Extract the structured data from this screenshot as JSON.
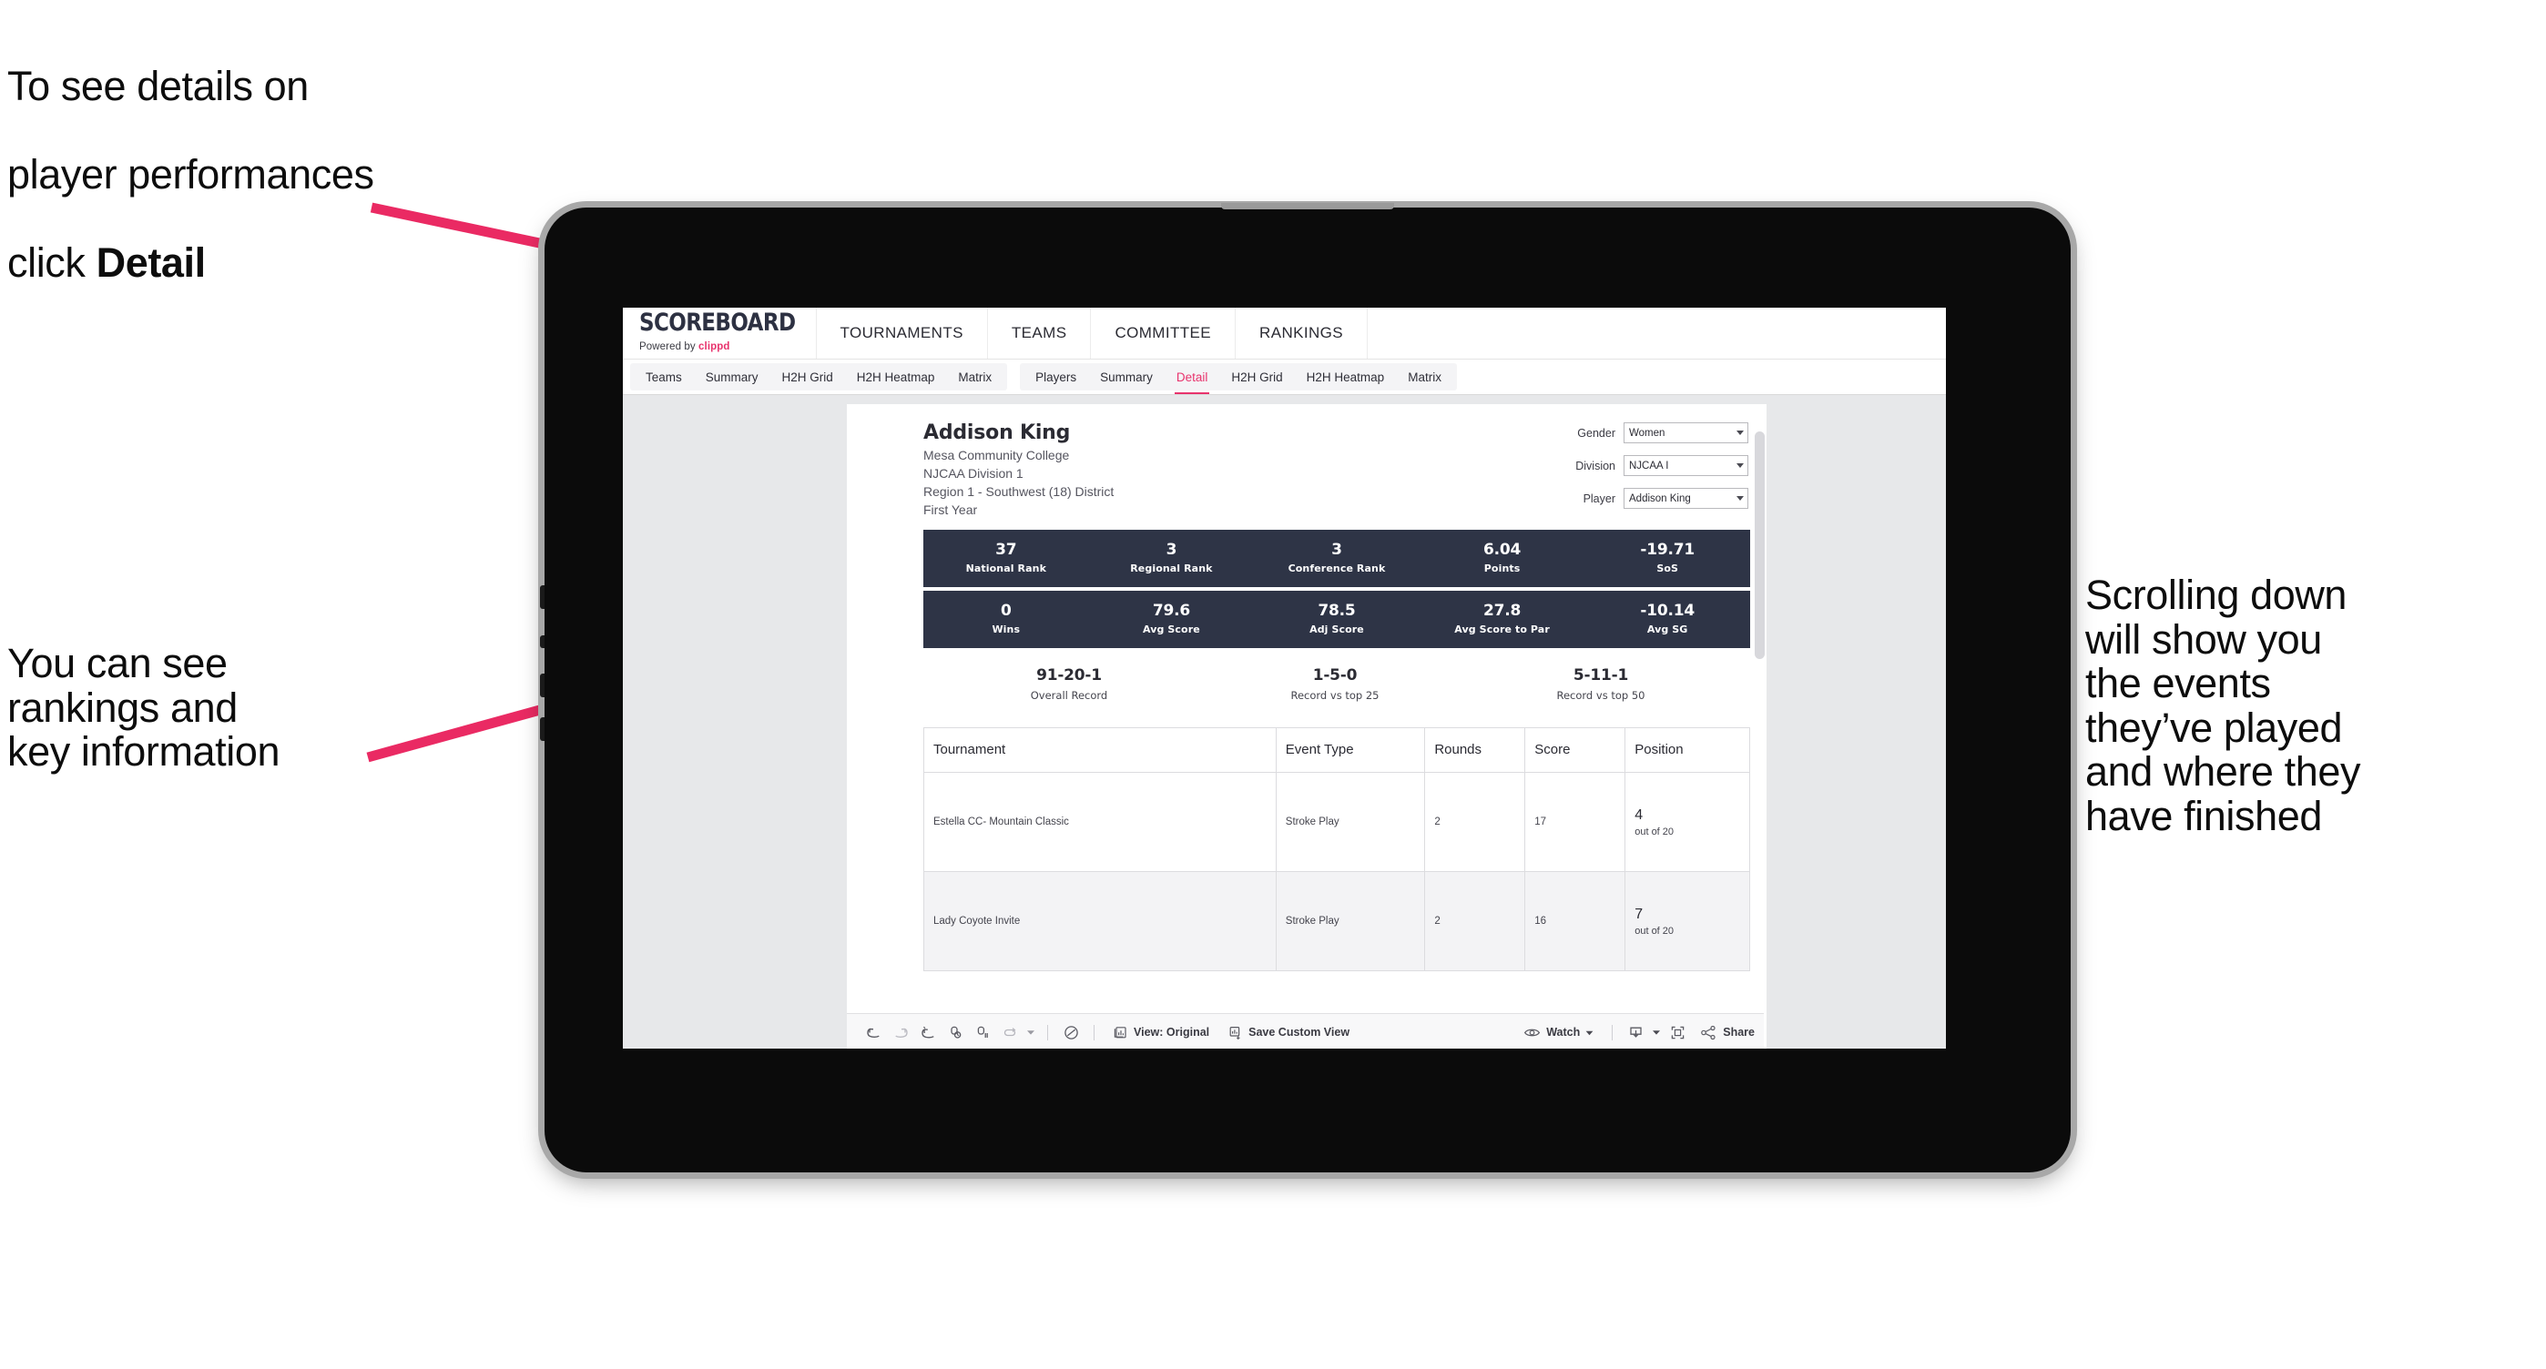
{
  "annotations": {
    "top": {
      "line1": "To see details on",
      "line2": "player performances",
      "line3_prefix": "click ",
      "line3_bold": "Detail"
    },
    "left": "You can see\nrankings and\nkey information",
    "right": "Scrolling down\nwill show you\nthe events\nthey’ve played\nand where they\nhave finished"
  },
  "colors": {
    "accent": "#e8336d",
    "banner": "#2e3446",
    "arrow": "#ea2a63",
    "canvas": "#e7e8ea"
  },
  "browser": {
    "header": {
      "brand_word": "SCOREBOARD",
      "brand_powered": "Powered by ",
      "brand_company": "clippd",
      "nav": [
        "TOURNAMENTS",
        "TEAMS",
        "COMMITTEE",
        "RANKINGS"
      ]
    },
    "tabstrip": {
      "group_teams": [
        "Teams",
        "Summary",
        "H2H Grid",
        "H2H Heatmap",
        "Matrix"
      ],
      "group_players": [
        "Players",
        "Summary",
        "Detail",
        "H2H Grid",
        "H2H Heatmap",
        "Matrix"
      ],
      "active_tab": "Detail"
    }
  },
  "viz": {
    "player": {
      "name": "Addison King",
      "school": "Mesa Community College",
      "division": "NJCAA Division 1",
      "region": "Region 1 - Southwest (18) District",
      "year": "First Year"
    },
    "filters": [
      {
        "label": "Gender",
        "value": "Women"
      },
      {
        "label": "Division",
        "value": "NJCAA I"
      },
      {
        "label": "Player",
        "value": "Addison King"
      }
    ],
    "stats_band_1": [
      {
        "value": "37",
        "label": "National Rank"
      },
      {
        "value": "3",
        "label": "Regional Rank"
      },
      {
        "value": "3",
        "label": "Conference Rank"
      },
      {
        "value": "6.04",
        "label": "Points"
      },
      {
        "value": "-19.71",
        "label": "SoS"
      }
    ],
    "stats_band_2": [
      {
        "value": "0",
        "label": "Wins"
      },
      {
        "value": "79.6",
        "label": "Avg Score"
      },
      {
        "value": "78.5",
        "label": "Adj Score"
      },
      {
        "value": "27.8",
        "label": "Avg Score to Par"
      },
      {
        "value": "-10.14",
        "label": "Avg SG"
      }
    ],
    "records": [
      {
        "value": "91-20-1",
        "label": "Overall Record"
      },
      {
        "value": "1-5-0",
        "label": "Record vs top 25"
      },
      {
        "value": "5-11-1",
        "label": "Record vs top 50"
      }
    ],
    "table": {
      "columns": [
        "Tournament",
        "Event Type",
        "Rounds",
        "Score",
        "Position"
      ],
      "rows": [
        {
          "tournament": "Estella CC- Mountain Classic",
          "event_type": "Stroke Play",
          "rounds": "2",
          "score": "17",
          "position": "4",
          "position_out_of": "out of 20"
        },
        {
          "tournament": "Lady Coyote Invite",
          "event_type": "Stroke Play",
          "rounds": "2",
          "score": "16",
          "position": "7",
          "position_out_of": "out of 20"
        }
      ]
    }
  },
  "toolbar": {
    "view_label": "View: Original",
    "save_label": "Save Custom View",
    "watch_label": "Watch",
    "share_label": "Share"
  }
}
